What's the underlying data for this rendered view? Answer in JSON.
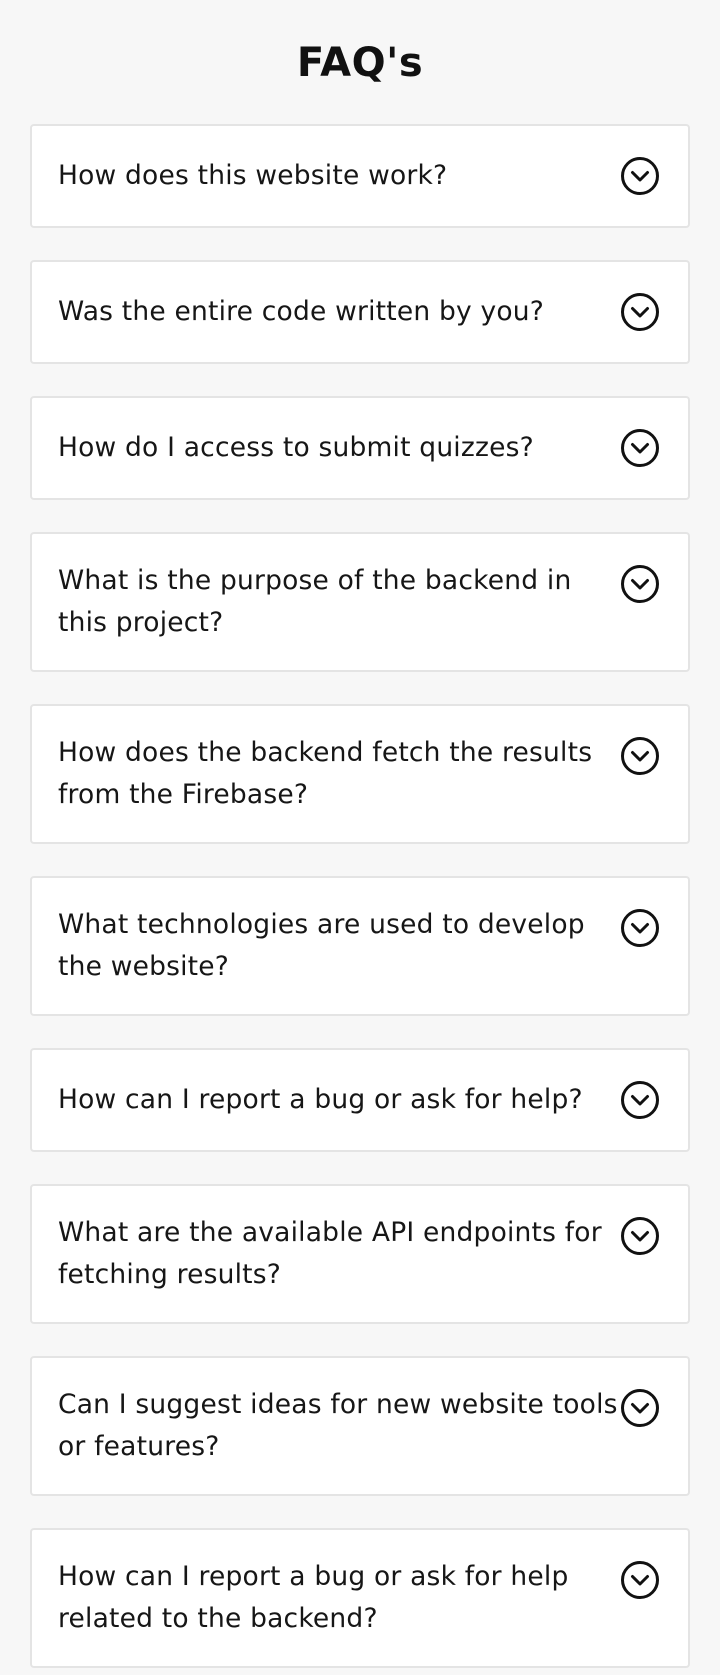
{
  "page": {
    "title": "FAQ's"
  },
  "faqs": [
    {
      "question": "How does this website work?",
      "icon": "chevron-down-circle-icon"
    },
    {
      "question": "Was the entire code written by you?",
      "icon": "chevron-down-circle-icon"
    },
    {
      "question": "How do I access to submit quizzes?",
      "icon": "chevron-down-circle-icon"
    },
    {
      "question": "What is the purpose of the backend in this project?",
      "icon": "chevron-down-circle-icon"
    },
    {
      "question": "How does the backend fetch the results from the Firebase?",
      "icon": "chevron-down-circle-icon"
    },
    {
      "question": "What technologies are used to develop the website?",
      "icon": "chevron-down-circle-icon"
    },
    {
      "question": "How can I report a bug or ask for help?",
      "icon": "chevron-down-circle-icon"
    },
    {
      "question": "What are the available API endpoints for fetching results?",
      "icon": "chevron-down-circle-icon"
    },
    {
      "question": "Can I suggest ideas for new website tools or features?",
      "icon": "chevron-down-circle-icon"
    },
    {
      "question": "How can I report a bug or ask for help related to the backend?",
      "icon": "chevron-down-circle-icon"
    }
  ],
  "colors": {
    "background": "#f7f7f7",
    "card": "#ffffff",
    "border": "#e4e4e4",
    "text": "#161616"
  }
}
